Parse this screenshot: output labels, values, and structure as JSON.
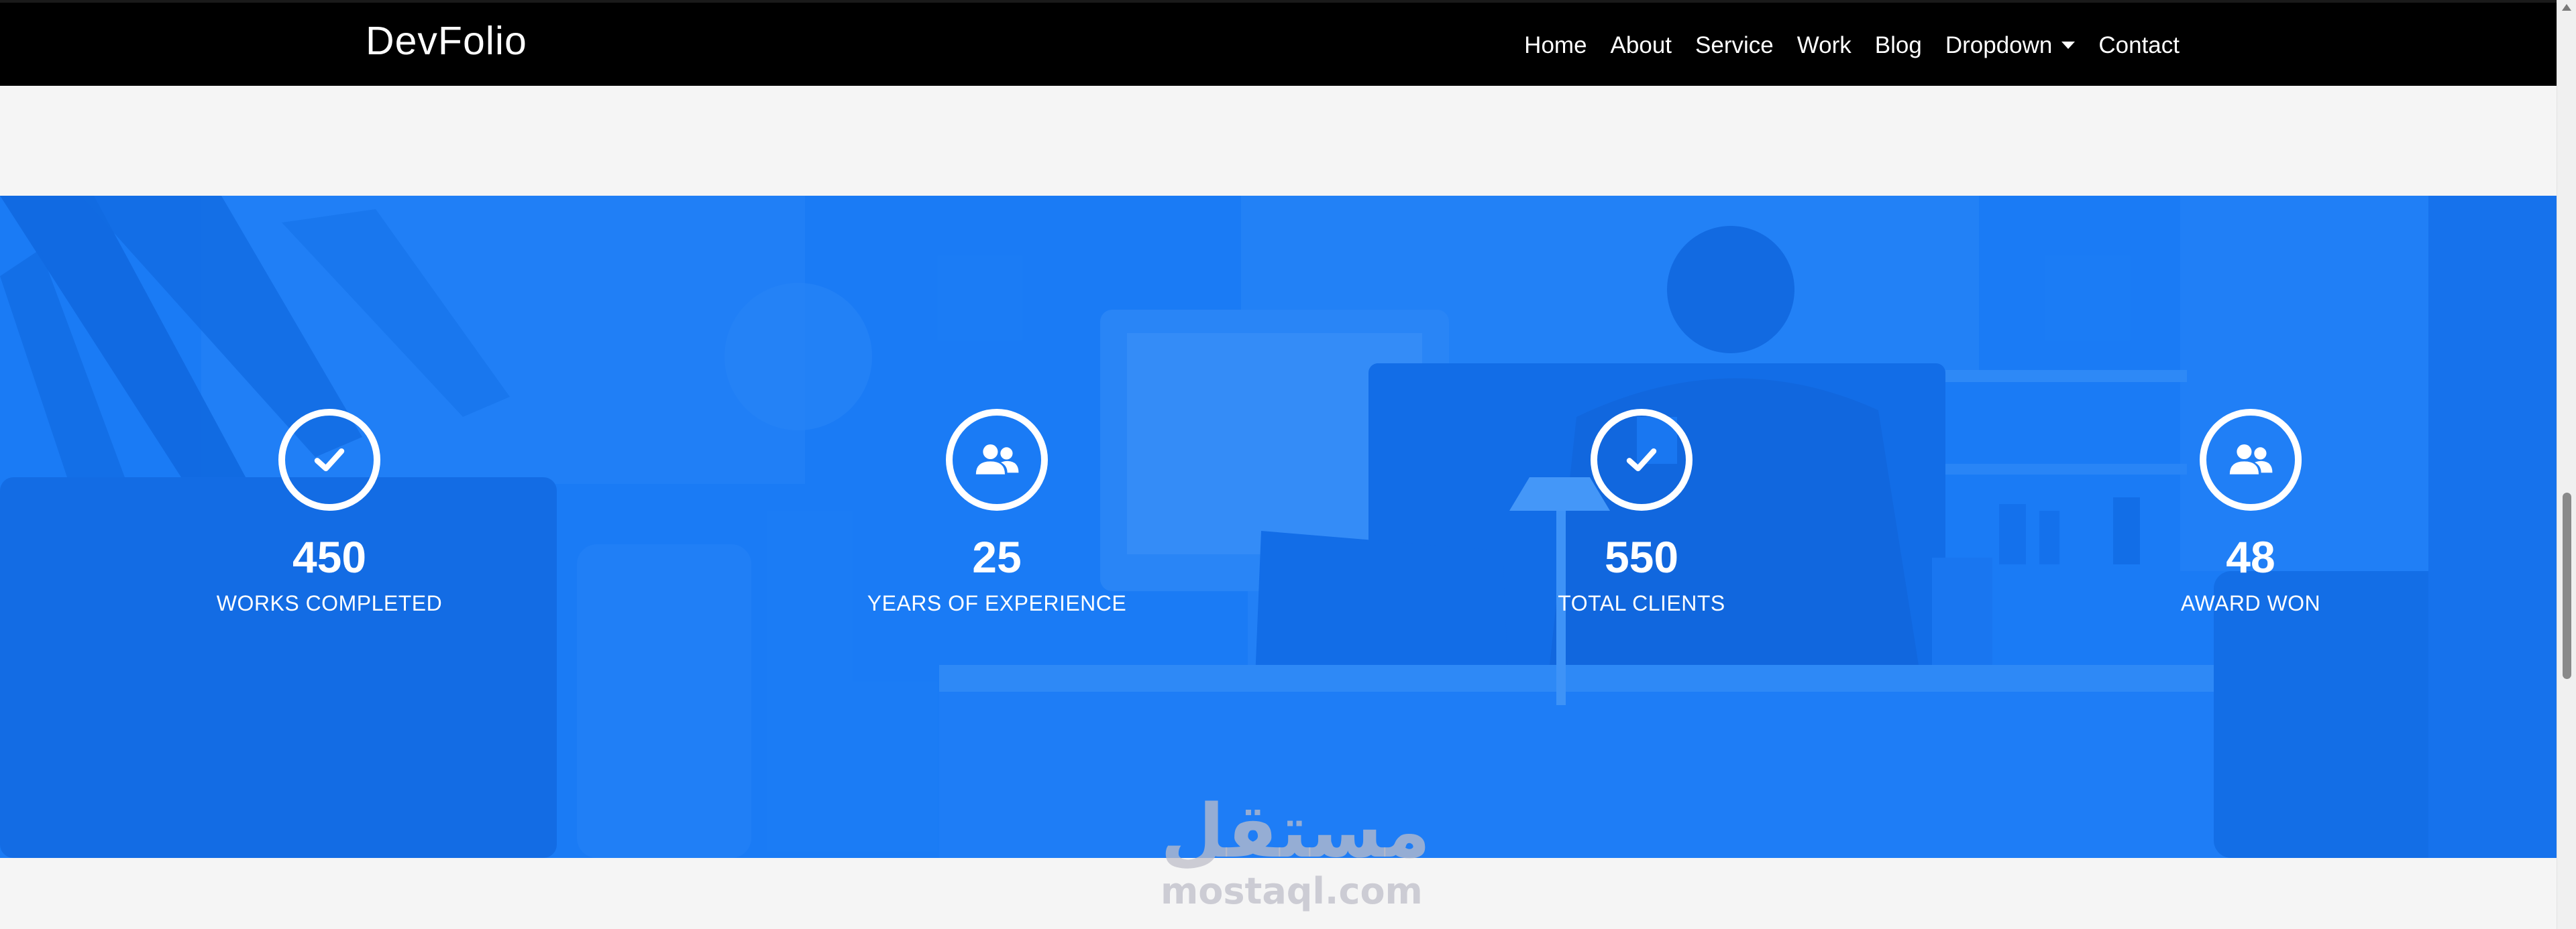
{
  "navbar": {
    "brand": "DevFolio",
    "links": [
      {
        "label": "Home"
      },
      {
        "label": "About"
      },
      {
        "label": "Service"
      },
      {
        "label": "Work"
      },
      {
        "label": "Blog"
      },
      {
        "label": "Dropdown",
        "has_caret": true
      },
      {
        "label": "Contact"
      }
    ]
  },
  "counters": [
    {
      "icon": "check-icon",
      "value": "450",
      "label": "WORKS COMPLETED"
    },
    {
      "icon": "users-icon",
      "value": "25",
      "label": "YEARS OF EXPERIENCE"
    },
    {
      "icon": "check-icon",
      "value": "550",
      "label": "TOTAL CLIENTS"
    },
    {
      "icon": "users-icon",
      "value": "48",
      "label": "AWARD WON"
    }
  ],
  "watermark": {
    "arabic": "مستقل",
    "latin": "mostaql.com"
  },
  "colors": {
    "navbar_bg": "#000000",
    "page_bg": "#f5f5f5",
    "accent_blue": "#0b75f5",
    "text_white": "#ffffff"
  }
}
